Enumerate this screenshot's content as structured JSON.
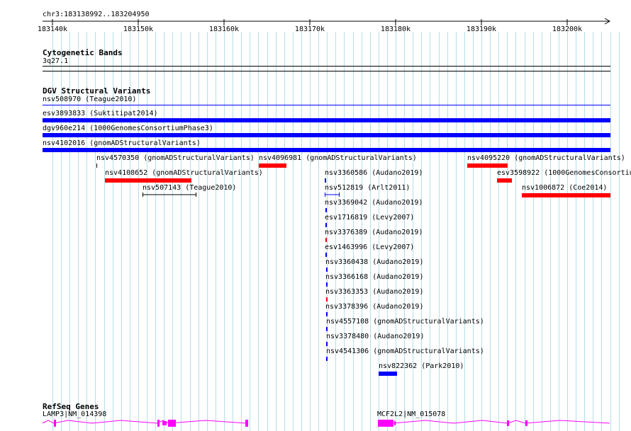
{
  "ruler": {
    "region": "chr3:183138992..183204950",
    "ticks": [
      "183140k",
      "183150k",
      "183160k",
      "183170k",
      "183180k",
      "183190k",
      "183200k"
    ]
  },
  "cytoband": {
    "title": "Cytogenetic Bands",
    "band": "3q27.1"
  },
  "dgv": {
    "title": "DGV Structural Variants",
    "rows": [
      {
        "label": "nsv508970 (Teague2010)",
        "color": "#0000ff"
      },
      {
        "label": "esv3893833 (Suktitipat2014)",
        "color": "#0000ff"
      },
      {
        "label": "dgv960e214 (1000GenomesConsortiumPhase3)",
        "color": "#0000ff"
      },
      {
        "label": "nsv4102016 (gnomADStructuralVariants)",
        "color": "#0000ff"
      }
    ],
    "features": [
      {
        "label": "nsv4570350 (gnomADStructuralVariants)",
        "color": "#000000"
      },
      {
        "label": "nsv4096981 (gnomADStructuralVariants)",
        "color": "#ff0000"
      },
      {
        "label": "nsv4095220 (gnomADStructuralVariants)",
        "color": "#ff0000"
      },
      {
        "label": "nsv4108652 (gnomADStructuralVariants)",
        "color": "#ff0000"
      },
      {
        "label": "nsv3360586 (Audano2019)",
        "color": "#0000ff"
      },
      {
        "label": "esv3598922 (1000GenomesConsortiu",
        "color": "#ff0000"
      },
      {
        "label": "nsv507143 (Teague2010)",
        "color": "#000000"
      },
      {
        "label": "nsv512819 (Arlt2011)",
        "color": "#0000ff"
      },
      {
        "label": "nsv1006872 (Coe2014)",
        "color": "#ff0000"
      },
      {
        "label": "nsv3369042 (Audano2019)",
        "color": "#0000ff"
      },
      {
        "label": "esv1716819 (Levy2007)",
        "color": "#0000ff"
      },
      {
        "label": "nsv3376389 (Audano2019)",
        "color": "#ff0000"
      },
      {
        "label": "esv1463996 (Levy2007)",
        "color": "#0000ff"
      },
      {
        "label": "nsv3360438 (Audano2019)",
        "color": "#0000ff"
      },
      {
        "label": "nsv3366168 (Audano2019)",
        "color": "#0000ff"
      },
      {
        "label": "nsv3363353 (Audano2019)",
        "color": "#ff0000"
      },
      {
        "label": "nsv3378396 (Audano2019)",
        "color": "#0000ff"
      },
      {
        "label": "nsv4557108 (gnomADStructuralVariants)",
        "color": "#0000ff"
      },
      {
        "label": "nsv3378480 (Audano2019)",
        "color": "#0000ff"
      },
      {
        "label": "nsv4541306 (gnomADStructuralVariants)",
        "color": "#0000ff"
      },
      {
        "label": "nsv822362 (Park2010)",
        "color": "#0000ff"
      }
    ]
  },
  "refseq": {
    "title": "RefSeq Genes",
    "genes": [
      {
        "label": "LAMP3|NM_014398",
        "color": "#ff00ff"
      },
      {
        "label": "MCF2L2|NM_015078",
        "color": "#ff00ff"
      }
    ]
  }
}
